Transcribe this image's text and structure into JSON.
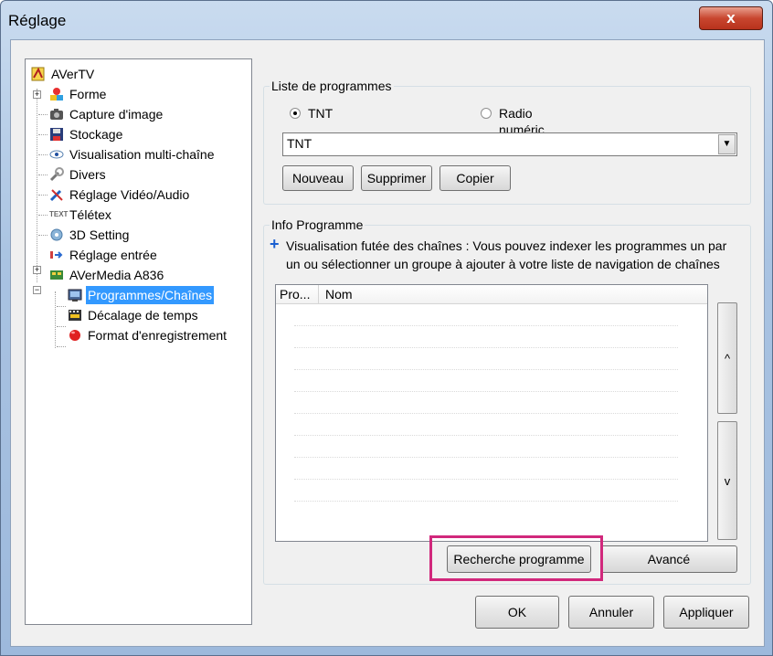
{
  "window": {
    "title": "Réglage",
    "close_label": "x"
  },
  "tree": {
    "items": [
      {
        "label": "AVerTV",
        "icon": "avertv-icon"
      },
      {
        "label": "Forme",
        "icon": "forme-icon"
      },
      {
        "label": "Capture d'image",
        "icon": "camera-icon"
      },
      {
        "label": "Stockage",
        "icon": "disk-icon"
      },
      {
        "label": "Visualisation multi-chaîne",
        "icon": "eye-icon"
      },
      {
        "label": "Divers",
        "icon": "tools-icon"
      },
      {
        "label": "Réglage Vidéo/Audio",
        "icon": "wrench-icon"
      },
      {
        "label": "Télétex",
        "icon": "text-icon",
        "icon_text": "TEXT"
      },
      {
        "label": "3D Setting",
        "icon": "3d-icon"
      },
      {
        "label": "Réglage entrée",
        "icon": "input-icon"
      },
      {
        "label": "AVerMedia A836",
        "icon": "device-icon"
      },
      {
        "label": "Programmes/Chaînes",
        "icon": "channel-icon"
      },
      {
        "label": "Décalage de temps",
        "icon": "timeshift-icon"
      },
      {
        "label": "Format d'enregistrement",
        "icon": "record-icon"
      }
    ],
    "selected": "Programmes/Chaînes"
  },
  "program_list": {
    "legend": "Liste de programmes",
    "radio_tnt": "TNT",
    "radio_radio": "Radio numéric",
    "selected_radio": "TNT",
    "combo_value": "TNT",
    "btn_new": "Nouveau",
    "btn_delete": "Supprimer",
    "btn_copy": "Copier"
  },
  "program_info": {
    "legend": "Info Programme",
    "line1": "Visualisation futée des chaînes : Vous pouvez indexer les programmes un par",
    "line2": "un ou sélectionner un groupe à ajouter à votre liste de navigation de chaînes",
    "col_pro": "Pro...",
    "col_nom": "Nom",
    "scroll_up": "^",
    "scroll_down": "v",
    "btn_search": "Recherche programme",
    "btn_advanced": "Avancé"
  },
  "footer": {
    "ok": "OK",
    "cancel": "Annuler",
    "apply": "Appliquer"
  },
  "colors": {
    "selection": "#3399ff",
    "highlight": "#d1287c",
    "close": "#c8462f"
  }
}
